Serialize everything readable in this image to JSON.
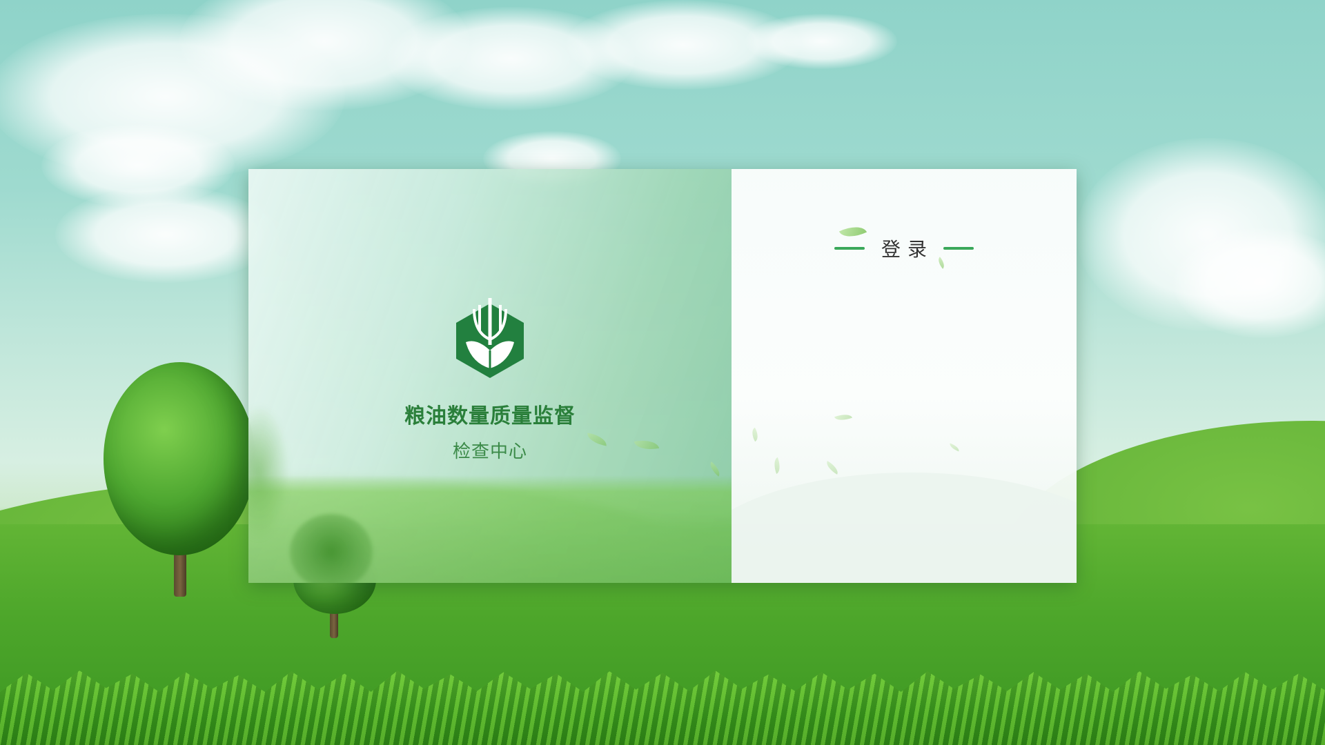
{
  "app": {
    "title_main": "粮油数量质量监督",
    "title_sub": "检查中心"
  },
  "login": {
    "heading": "登录"
  },
  "colors": {
    "brand_green": "#2a7f3a",
    "accent_line": "#3aa85a",
    "logo_fill": "#22803f"
  },
  "icons": {
    "logo": "wheat-shield-icon"
  }
}
